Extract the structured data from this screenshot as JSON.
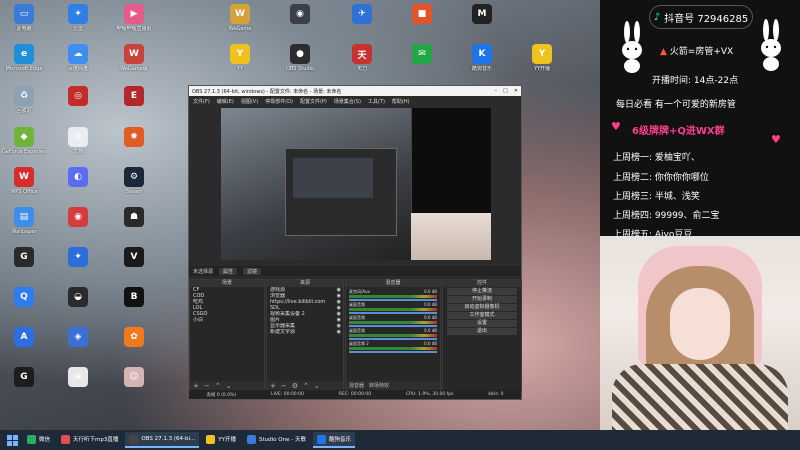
{
  "desktop": {
    "icons": [
      {
        "label": "此电脑",
        "color": "#3b7bd8",
        "glyph": "▭",
        "col": 0,
        "row": 0
      },
      {
        "label": "迅雷",
        "color": "#2e7fe6",
        "glyph": "✦",
        "col": 1,
        "row": 0
      },
      {
        "label": "哔哩哔哩直播姬",
        "color": "#e75b8c",
        "glyph": "▶",
        "col": 2,
        "row": 0
      },
      {
        "label": "WeGame",
        "color": "#d3a23a",
        "glyph": "W",
        "col": 3,
        "row": 0
      },
      {
        "label": "",
        "color": "#3a3f4a",
        "glyph": "◉",
        "col": 4,
        "row": 0
      },
      {
        "label": "",
        "color": "#2f6fd6",
        "glyph": "✈",
        "col": 5,
        "row": 0
      },
      {
        "label": "",
        "color": "#e2542c",
        "glyph": "■",
        "col": 6,
        "row": 0
      },
      {
        "label": "",
        "color": "#222222",
        "glyph": "M",
        "col": 7,
        "row": 0
      },
      {
        "label": "Microsoft Edge",
        "color": "#1f8fd8",
        "glyph": "e",
        "col": 0,
        "row": 1
      },
      {
        "label": "百度网盘",
        "color": "#3c8ff0",
        "glyph": "☁",
        "col": 1,
        "row": 1
      },
      {
        "label": "WeGame版",
        "color": "#c9433a",
        "glyph": "W",
        "col": 2,
        "row": 1
      },
      {
        "label": "YY",
        "color": "#f0c21c",
        "glyph": "Y",
        "col": 3,
        "row": 1
      },
      {
        "label": "OBS Studio",
        "color": "#2d2d2d",
        "glyph": "●",
        "col": 4,
        "row": 1
      },
      {
        "label": "天刀",
        "color": "#c6332f",
        "glyph": "天",
        "col": 5,
        "row": 1
      },
      {
        "label": "",
        "color": "#21a844",
        "glyph": "✉",
        "col": 6,
        "row": 1
      },
      {
        "label": "酷狗音乐",
        "color": "#1e74e8",
        "glyph": "K",
        "col": 7,
        "row": 1
      },
      {
        "label": "YY开播",
        "color": "#f0c21c",
        "glyph": "Y",
        "col": 8,
        "row": 1
      },
      {
        "label": "回收站",
        "color": "#8ea0b4",
        "glyph": "♻",
        "col": 0,
        "row": 2
      },
      {
        "label": "",
        "color": "#c42b2b",
        "glyph": "◎",
        "col": 1,
        "row": 2
      },
      {
        "label": "",
        "color": "#b3262b",
        "glyph": "E",
        "col": 2,
        "row": 2
      },
      {
        "label": "GeForce Experience",
        "color": "#70b53a",
        "glyph": "◆",
        "col": 0,
        "row": 3
      },
      {
        "label": "文档",
        "color": "#e9ecf0",
        "glyph": "≡",
        "col": 1,
        "row": 3
      },
      {
        "label": "",
        "color": "#e15b23",
        "glyph": "✹",
        "col": 2,
        "row": 3
      },
      {
        "label": "WPS Office",
        "color": "#d82c2c",
        "glyph": "W",
        "col": 0,
        "row": 4
      },
      {
        "label": "",
        "color": "#5a6cf0",
        "glyph": "◐",
        "col": 1,
        "row": 4
      },
      {
        "label": "Steam",
        "color": "#1b2838",
        "glyph": "⚙",
        "col": 2,
        "row": 4
      },
      {
        "label": "Wallpaper",
        "color": "#3c8ee8",
        "glyph": "▤",
        "col": 0,
        "row": 5
      },
      {
        "label": "",
        "color": "#d63c3c",
        "glyph": "◉",
        "col": 1,
        "row": 5
      },
      {
        "label": "",
        "color": "#2a2a2a",
        "glyph": "☗",
        "col": 2,
        "row": 5
      },
      {
        "label": "",
        "color": "#2a2a2a",
        "glyph": "G",
        "col": 0,
        "row": 6
      },
      {
        "label": "",
        "color": "#2a6fd8",
        "glyph": "✦",
        "col": 1,
        "row": 6
      },
      {
        "label": "",
        "color": "#1a1a1a",
        "glyph": "V",
        "col": 2,
        "row": 6
      },
      {
        "label": "",
        "color": "#2e7cf0",
        "glyph": "Q",
        "col": 0,
        "row": 7
      },
      {
        "label": "",
        "color": "#2b2b2b",
        "glyph": "◒",
        "col": 1,
        "row": 7
      },
      {
        "label": "",
        "color": "#111111",
        "glyph": "B",
        "col": 2,
        "row": 7
      },
      {
        "label": "",
        "color": "#2f6ee0",
        "glyph": "A",
        "col": 0,
        "row": 8
      },
      {
        "label": "",
        "color": "#3b6fd8",
        "glyph": "◈",
        "col": 1,
        "row": 8
      },
      {
        "label": "",
        "color": "#f07a1c",
        "glyph": "✿",
        "col": 2,
        "row": 8
      },
      {
        "label": "",
        "color": "#1d1d1d",
        "glyph": "G",
        "col": 0,
        "row": 9
      },
      {
        "label": "",
        "color": "#e8e8e8",
        "glyph": "≡",
        "col": 1,
        "row": 9
      },
      {
        "label": "",
        "color": "#d7b4b4",
        "glyph": "☺",
        "col": 2,
        "row": 9
      }
    ]
  },
  "obs": {
    "title": "OBS 27.1.3 (64-bit, windows) - 配置文件: 未命名 - 场景: 未命名",
    "menu": [
      "文件(F)",
      "编辑(E)",
      "视图(V)",
      "停靠部件(D)",
      "配置文件(P)",
      "场景集合(S)",
      "工具(T)",
      "帮助(H)"
    ],
    "toolbar": {
      "no_source": "未选择源",
      "props": "属性",
      "filters": "滤镜"
    },
    "docks": {
      "scenes": {
        "title": "场景",
        "items": [
          "CF",
          "COD",
          "吃鸡",
          "LOL",
          "CSGO",
          "小白"
        ]
      },
      "sources": {
        "title": "来源",
        "items": [
          "游戏源",
          "浏览器",
          "https://live.bilibili.com",
          "SDL",
          "视频采集设备 2",
          "图片",
          "显示器采集",
          "新建文字源"
        ]
      },
      "mixer": {
        "title": "混音器",
        "rows": [
          {
            "name": "麦克风/Aux",
            "db": "0.0 dB"
          },
          {
            "name": "桌面音频",
            "db": "0.0 dB"
          },
          {
            "name": "桌面音频",
            "db": "0.0 dB"
          },
          {
            "name": "桌面音频",
            "db": "0.0 dB"
          },
          {
            "name": "桌面音频 2",
            "db": "0.0 dB"
          }
        ],
        "tabs": [
          "混音器",
          "转场特效"
        ]
      },
      "controls": {
        "title": "控件",
        "buttons": [
          "停止推流",
          "开始录制",
          "启动虚拟摄像机",
          "工作室模式",
          "设置",
          "退出"
        ]
      }
    },
    "status": {
      "dropped": "丢帧 0 (0.0%)",
      "live": "LIVE: 00:00:00",
      "rec": "REC: 00:00:00",
      "cpu": "CPU: 1.9%, 30.00 fps",
      "kbps": "kb/s: 0"
    }
  },
  "panel": {
    "douyin": "抖音号 72946285",
    "line1": "火箭=房管+VX",
    "rec_label": "开播时间:",
    "rec_time": "14点-22点",
    "line2": "每日必看 有一个可爱的新房管",
    "line3": "6级牌牌+Q进WX群",
    "ranks": [
      "上周榜一: 爱柚宝吖、",
      "上周榜二: 你你你你哪位",
      "上周榜三: 半城、浅笑",
      "上周榜四: 99999、俞二宝",
      "上周榜五: Aiyo豆豆"
    ]
  },
  "taskbar": {
    "items": [
      {
        "label": "微信",
        "color": "#2aae67",
        "active": false
      },
      {
        "label": "天行听下mp3直播",
        "color": "#e24f4f",
        "active": false
      },
      {
        "label": "OBS 27.1.3 (64-bi...",
        "color": "#444444",
        "active": true
      },
      {
        "label": "YY开播",
        "color": "#f0c21c",
        "active": false
      },
      {
        "label": "Studio One - 天歌",
        "color": "#3a7bd5",
        "active": false
      },
      {
        "label": "酷狗音乐",
        "color": "#1e74e8",
        "active": true
      }
    ]
  }
}
